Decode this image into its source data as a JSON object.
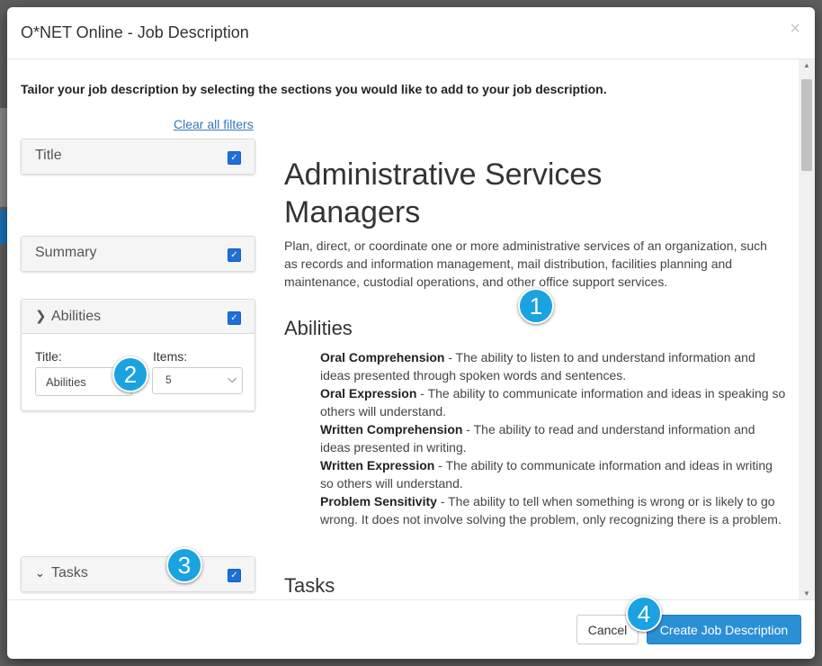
{
  "modal": {
    "title": "O*NET Online - Job Description",
    "close_glyph": "×"
  },
  "intro": "Tailor your job description by selecting the sections you would like to add to your job description.",
  "clear_filters": "Clear all filters",
  "panels": {
    "title": {
      "label": "Title",
      "checked": true
    },
    "summary": {
      "label": "Summary",
      "checked": true
    },
    "abilities": {
      "label": "Abilities",
      "checked": true,
      "title_field_label": "Title:",
      "title_field_value": "Abilities",
      "items_label": "Items:",
      "items_value": "5"
    },
    "tasks": {
      "label": "Tasks",
      "checked": true
    }
  },
  "content": {
    "job_title": "Administrative Services Managers",
    "summary": "Plan, direct, or coordinate one or more administrative services of an organization, such as records and information management, mail distribution, facilities planning and maintenance, custodial operations, and other office support services.",
    "abilities_heading": "Abilities",
    "abilities": [
      {
        "name": "Oral Comprehension",
        "desc": " - The ability to listen to and understand information and ideas presented through spoken words and sentences."
      },
      {
        "name": "Oral Expression",
        "desc": " - The ability to communicate information and ideas in speaking so others will understand."
      },
      {
        "name": "Written Comprehension",
        "desc": " - The ability to read and understand information and ideas presented in writing."
      },
      {
        "name": "Written Expression",
        "desc": " - The ability to communicate information and ideas in writing so others will understand."
      },
      {
        "name": "Problem Sensitivity",
        "desc": " - The ability to tell when something is wrong or is likely to go wrong. It does not involve solving the problem, only recognizing there is a problem."
      }
    ],
    "tasks_heading": "Tasks"
  },
  "footer": {
    "cancel": "Cancel",
    "create": "Create Job Description"
  },
  "badges": [
    "1",
    "2",
    "3",
    "4"
  ],
  "colors": {
    "primary": "#2b8fd6",
    "link": "#337ab7",
    "checkbox": "#1e6fd9",
    "badge": "#1aa3e0"
  }
}
